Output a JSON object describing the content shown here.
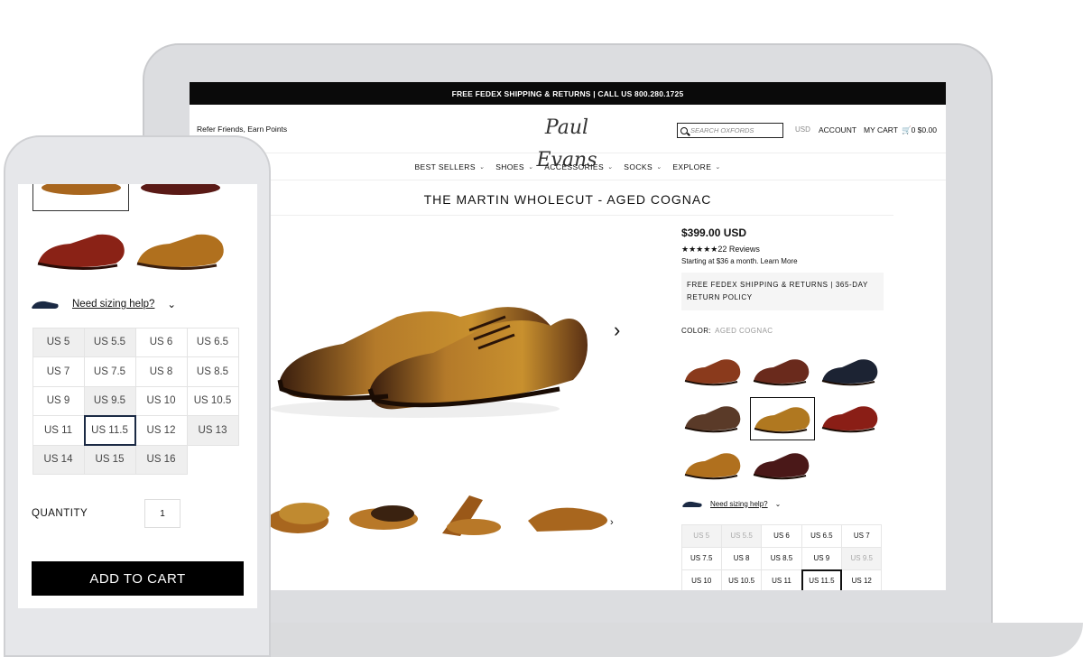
{
  "site": {
    "promo_text": "FREE FEDEX SHIPPING & RETURNS | CALL US 800.280.1725",
    "refer_link": "Refer Friends, Earn Points",
    "logo_text": "Paul Evans",
    "search_placeholder": "SEARCH OXFORDS",
    "currency": "USD",
    "account": "ACCOUNT",
    "cart_label": "MY CART",
    "cart_info": "0 $0.00",
    "nav": [
      "BEST SELLERS",
      "SHOES",
      "ACCESSORIES",
      "SOCKS",
      "EXPLORE"
    ]
  },
  "product": {
    "title": "THE MARTIN WHOLECUT - AGED COGNAC",
    "price": "$399.00 USD",
    "stars": "★★★★★",
    "reviews": "22 Reviews",
    "financing": "Starting at $36 a month. Learn More",
    "shipping_note": "FREE FEDEX SHIPPING & RETURNS | 365-DAY RETURN POLICY",
    "color_label": "COLOR:",
    "color_value": "AGED COGNAC",
    "sizing_help": "Need sizing help?",
    "sizes": [
      {
        "label": "US 5",
        "oos": true
      },
      {
        "label": "US 5.5",
        "oos": true
      },
      {
        "label": "US 6",
        "oos": false
      },
      {
        "label": "US 6.5",
        "oos": false
      },
      {
        "label": "US 7",
        "oos": false
      },
      {
        "label": "US 7.5",
        "oos": false
      },
      {
        "label": "US 8",
        "oos": false
      },
      {
        "label": "US 8.5",
        "oos": false
      },
      {
        "label": "US 9",
        "oos": false
      },
      {
        "label": "US 9.5",
        "oos": true
      },
      {
        "label": "US 10",
        "oos": false
      },
      {
        "label": "US 10.5",
        "oos": false
      },
      {
        "label": "US 11",
        "oos": false
      },
      {
        "label": "US 11.5",
        "oos": false,
        "selected": true
      },
      {
        "label": "US 12",
        "oos": false
      }
    ],
    "swatch_colors": [
      "#8a3a1c",
      "#6a2a1c",
      "#1c2333",
      "#5a3a28",
      "#b07820",
      "#8a1e16",
      "#b0701e",
      "#4a1818"
    ]
  },
  "mobile": {
    "sizing_help": "Need sizing help?",
    "sizes": [
      {
        "label": "US 5",
        "oos": true
      },
      {
        "label": "US 5.5",
        "oos": true
      },
      {
        "label": "US 6",
        "oos": false
      },
      {
        "label": "US 6.5",
        "oos": false
      },
      {
        "label": "US 7",
        "oos": false
      },
      {
        "label": "US 7.5",
        "oos": false
      },
      {
        "label": "US 8",
        "oos": false
      },
      {
        "label": "US 8.5",
        "oos": false
      },
      {
        "label": "US 9",
        "oos": false
      },
      {
        "label": "US 9.5",
        "oos": true
      },
      {
        "label": "US 10",
        "oos": false
      },
      {
        "label": "US 10.5",
        "oos": false
      },
      {
        "label": "US 11",
        "oos": false
      },
      {
        "label": "US 11.5",
        "oos": false,
        "selected": true
      },
      {
        "label": "US 12",
        "oos": false
      },
      {
        "label": "US 13",
        "oos": true
      },
      {
        "label": "US 14",
        "oos": true
      },
      {
        "label": "US 15",
        "oos": true
      },
      {
        "label": "US 16",
        "oos": true
      }
    ],
    "quantity_label": "QUANTITY",
    "quantity": "1",
    "add_to_cart": "ADD TO CART"
  }
}
